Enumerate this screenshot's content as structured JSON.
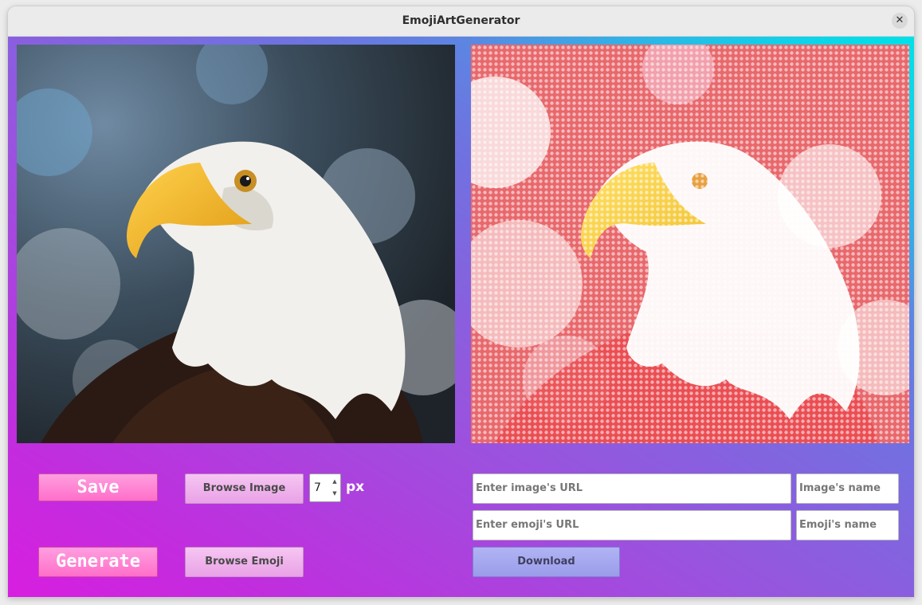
{
  "window": {
    "title": "EmojiArtGenerator"
  },
  "colors": {
    "save_button": "#ff7fd1",
    "download_button": "#a4a6ee"
  },
  "left_panel": {
    "save_label": "Save",
    "generate_label": "Generate",
    "browse_image_label": "Browse Image",
    "browse_emoji_label": "Browse Emoji",
    "pixel_size": {
      "value": "7",
      "unit": "px"
    }
  },
  "right_panel": {
    "image_url_placeholder": "Enter image's URL",
    "image_name_placeholder": "Image's name",
    "emoji_url_placeholder": "Enter emoji's URL",
    "emoji_name_placeholder": "Emoji's name",
    "download_label": "Download"
  }
}
